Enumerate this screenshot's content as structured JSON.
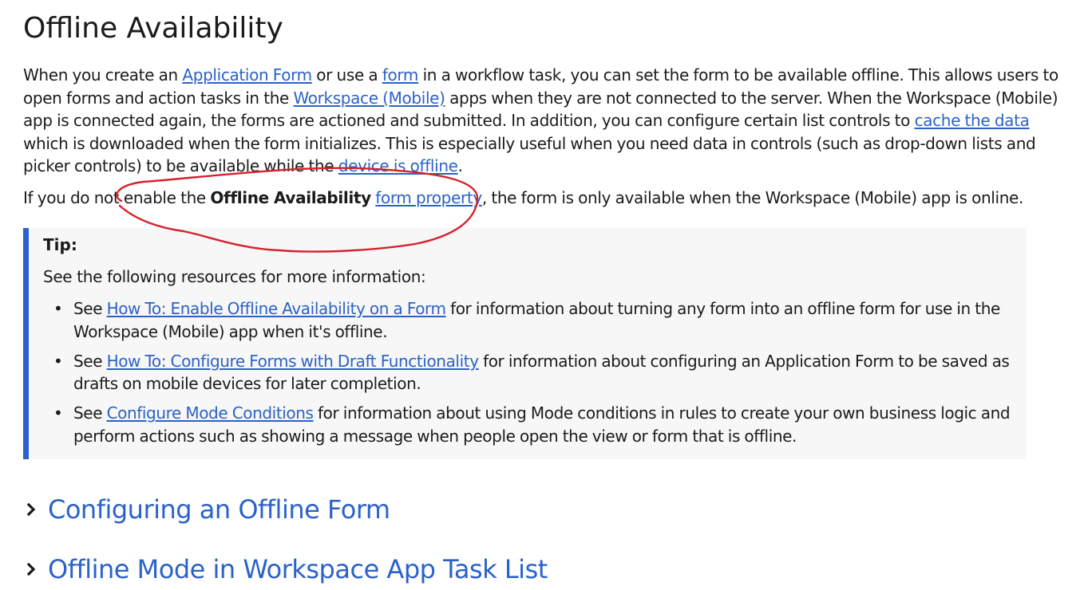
{
  "page_title": "Offline Availability",
  "intro": {
    "t1": "When you create an ",
    "link_application_form": "Application Form",
    "t2": " or use a ",
    "link_form": "form",
    "t3": " in a workflow task, you can set the form to be available offline. This allows users to open forms and action tasks in the ",
    "link_workspace_mobile": "Workspace (Mobile)",
    "t4": " apps when they are not connected to the server. When the Workspace (Mobile) app is connected again, the forms are actioned and submitted. In addition, you can configure certain list controls to ",
    "link_cache_data": "cache the data",
    "t5": " which is downloaded when the form initializes. This is especially useful when you need data in controls (such as drop-down lists and picker controls) to be available while the ",
    "link_device_offline": "device is offline",
    "t6": "."
  },
  "second_paragraph": {
    "t1": "If you do not enable the ",
    "bold": "Offline Availability",
    "t2": " ",
    "link_form_property": "form property",
    "t3": ", the form is only available when the Workspace (Mobile) app is online."
  },
  "tip": {
    "title": "Tip:",
    "intro": "See the following resources for more information:",
    "items": [
      {
        "prefix": "See ",
        "link": "How To: Enable Offline Availability on a Form",
        "suffix": " for information about turning any form into an offline form for use in the Workspace (Mobile) app when it's offline."
      },
      {
        "prefix": "See ",
        "link": "How To: Configure Forms with Draft Functionality",
        "suffix": " for information about configuring an Application Form to be saved as drafts on mobile devices for later completion."
      },
      {
        "prefix": "See ",
        "link": "Configure Mode Conditions",
        "suffix": " for information about using Mode conditions in rules to create your own business logic and perform actions such as showing a message when people open the view or form that is offline."
      }
    ]
  },
  "sections": [
    {
      "title": "Configuring an Offline Form",
      "icon": "chevron-right-icon"
    },
    {
      "title": "Offline Mode in Workspace App Task List",
      "icon": "chevron-right-icon"
    }
  ],
  "colors": {
    "link": "#2b62c9",
    "text": "#1b1b1b",
    "tip_background": "#f7f7f7",
    "tip_border": "#2b62c9",
    "annotation": "#d6222c"
  }
}
